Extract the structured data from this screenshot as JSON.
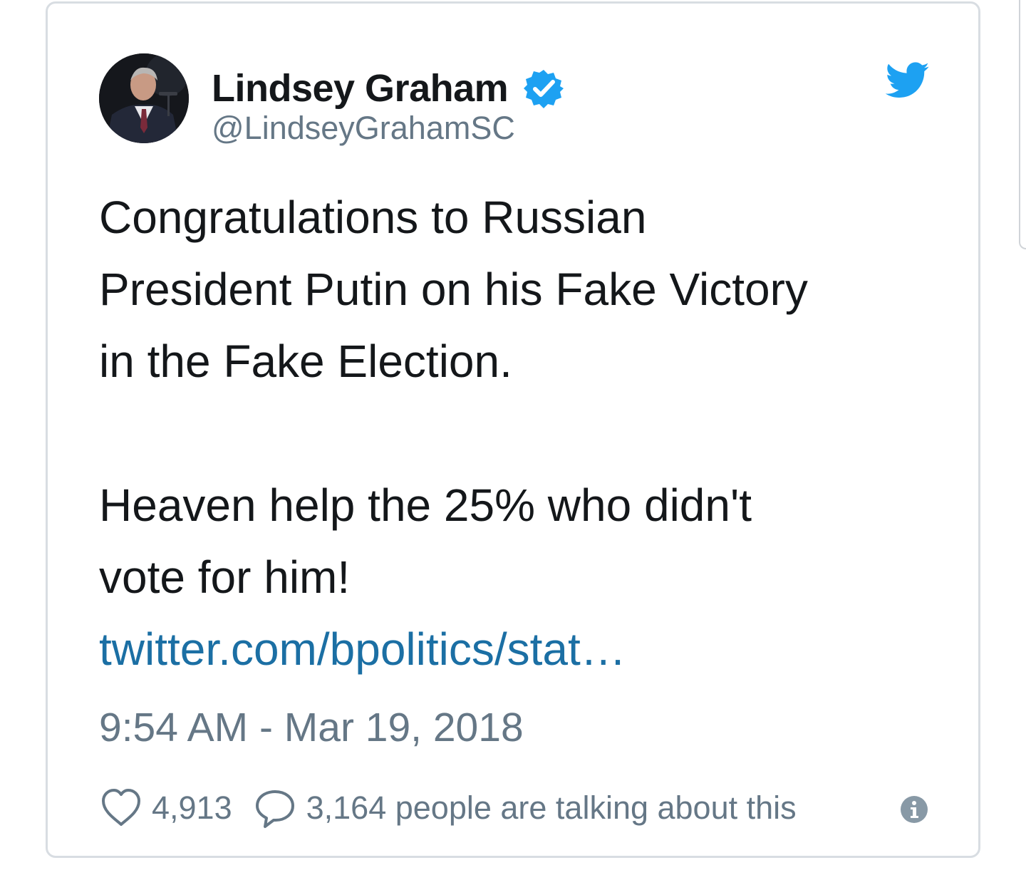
{
  "tweet": {
    "author": {
      "display_name": "Lindsey Graham",
      "handle": "@LindseyGrahamSC",
      "verified": true
    },
    "text_paragraph_1": "Congratulations to Russian\nPresident Putin on his Fake Victory\nin the Fake Election.",
    "text_paragraph_2": "Heaven help the 25% who didn't\nvote for him!",
    "link_text": "twitter.com/bpolitics/stat…",
    "timestamp": "9:54 AM - Mar 19, 2018",
    "like_count": "4,913",
    "talking_text": "3,164 people are talking about this"
  },
  "icons": {
    "avatar": "avatar-photo",
    "verified": "verified-badge-icon",
    "brand": "twitter-bird-icon",
    "like": "heart-icon",
    "reply": "speech-bubble-icon",
    "info": "info-icon"
  },
  "colors": {
    "twitter_blue": "#1da1f2",
    "link": "#1b6fa4",
    "text_primary": "#14171a",
    "text_secondary": "#657786",
    "card_border": "#d8dde2"
  }
}
